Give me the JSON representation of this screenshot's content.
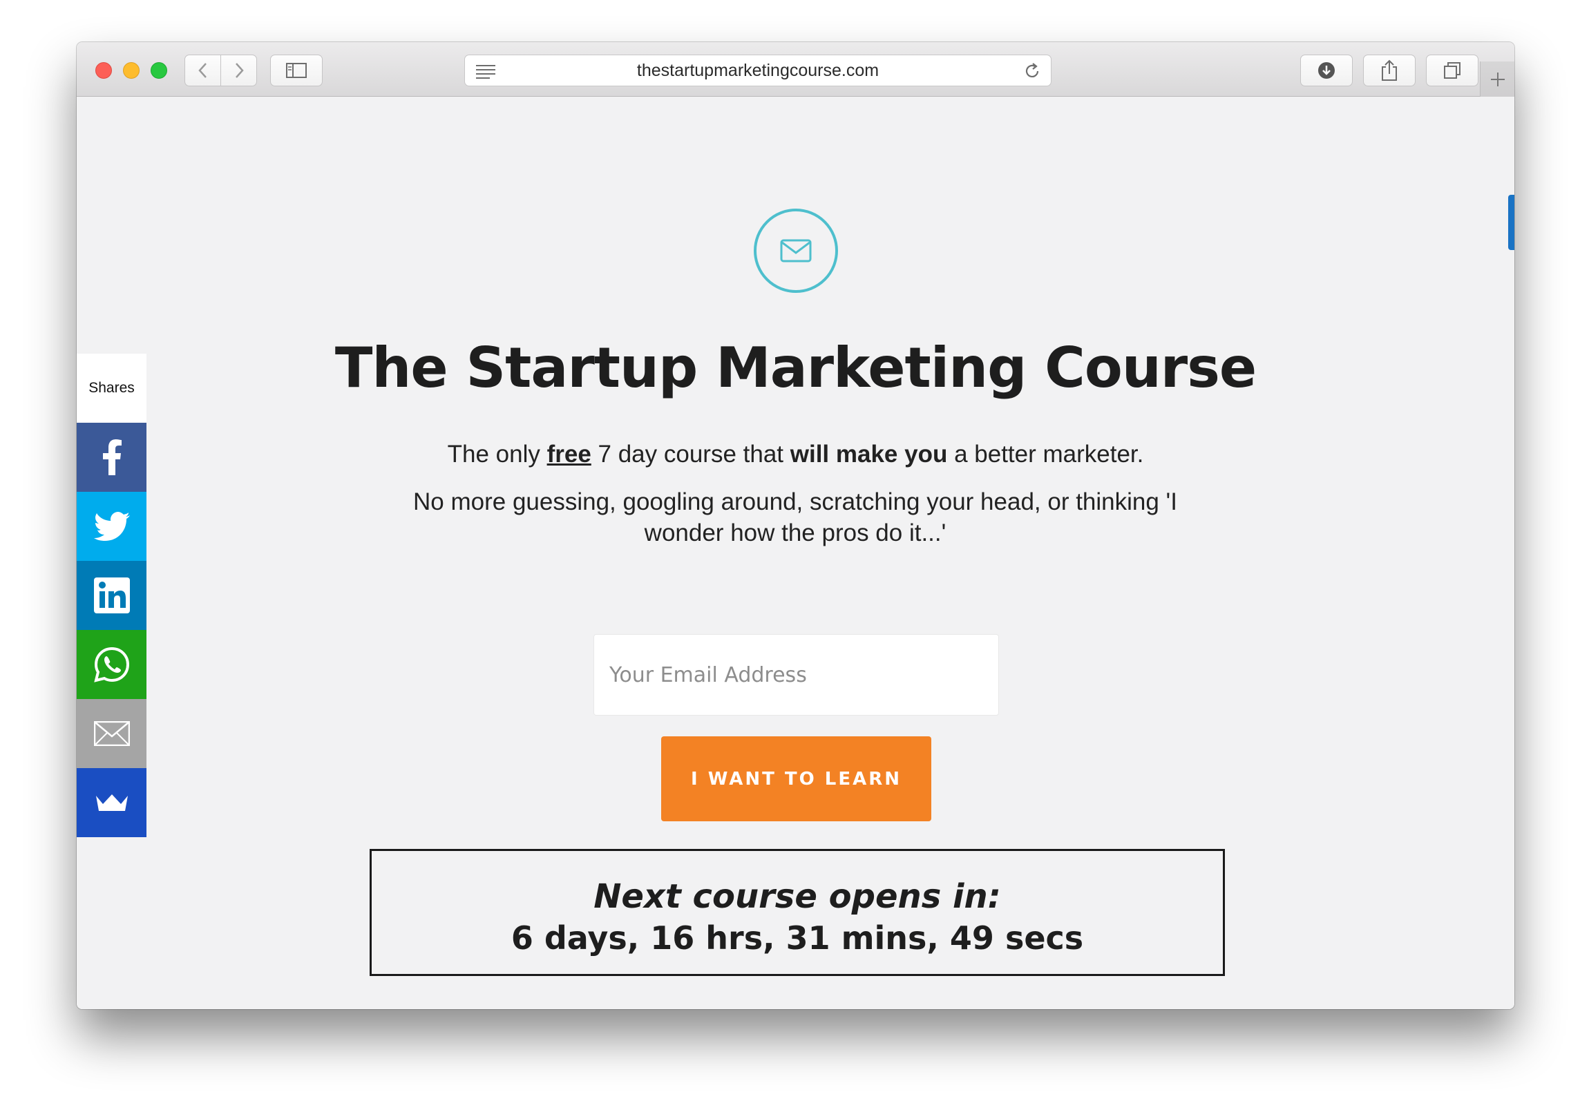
{
  "browser": {
    "url": "thestartupmarketingcourse.com"
  },
  "icons": {
    "mail": "envelope-icon",
    "facebook": "facebook-icon",
    "twitter": "twitter-icon",
    "linkedin": "linkedin-icon",
    "whatsapp": "whatsapp-icon",
    "email_share": "email-icon",
    "crown": "crown-icon"
  },
  "colors": {
    "accent_teal": "#4ebfcd",
    "cta_orange": "#f38224",
    "facebook": "#3b5998",
    "twitter": "#00aced",
    "linkedin": "#007bb6",
    "whatsapp": "#1fa319",
    "email": "#a5a5a5",
    "crown": "#1a4ec2"
  },
  "page": {
    "title": "The Startup Marketing Course",
    "tagline": {
      "pre": "The only ",
      "free": "free",
      "mid": " 7 day course that ",
      "strong": "will make you",
      "post": " a better marketer."
    },
    "subtext": "No more guessing, googling around, scratching your head, or thinking 'I wonder how the pros do it...'",
    "email_placeholder": "Your Email Address",
    "cta_label": "I WANT TO LEARN",
    "countdown_label": "Next course opens in:",
    "countdown_value": "6 days, 16 hrs, 31 mins, 49 secs"
  },
  "sharebar": {
    "label": "Shares"
  }
}
